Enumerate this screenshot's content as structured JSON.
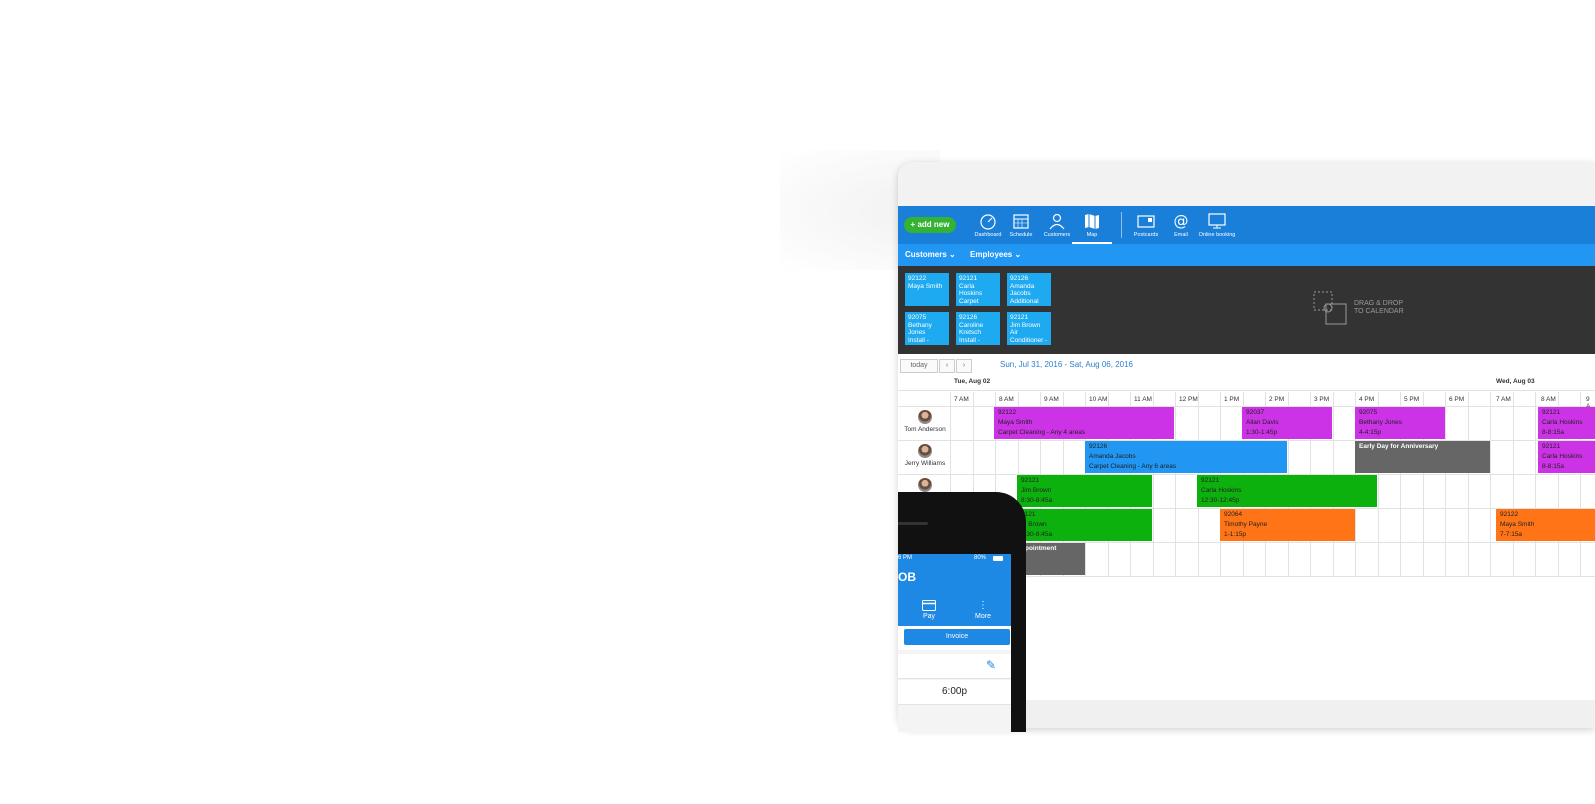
{
  "topbar": {
    "add_new": "+ add new",
    "nav": [
      {
        "label": "Dashboard",
        "icon": "dashboard-icon"
      },
      {
        "label": "Schedule",
        "icon": "calendar-icon"
      },
      {
        "label": "Customers",
        "icon": "person-icon"
      },
      {
        "label": "Map",
        "icon": "map-icon",
        "active": true
      },
      {
        "label": "Postcards",
        "icon": "postcard-icon"
      },
      {
        "label": "Email",
        "icon": "at-icon"
      },
      {
        "label": "Online booking",
        "icon": "monitor-icon"
      }
    ]
  },
  "subbar": {
    "customers": "Customers",
    "employees": "Employees"
  },
  "unscheduled_jobs": [
    {
      "text": "92122\nMaya Smith"
    },
    {
      "text": "92121\nCarla\nHoskins\nCarpet"
    },
    {
      "text": "92126\nAmanda\nJacobs\nAdditional"
    },
    {
      "text": "92075\nBethany\nJones\nInstall -"
    },
    {
      "text": "92126\nCaroline\nKretsch\nInstall -"
    },
    {
      "text": "92121\nJim Brown\nAir\nConditioner -"
    }
  ],
  "drag_drop": {
    "line1": "DRAG & DROP",
    "line2": "TO CALENDAR"
  },
  "datebar": {
    "today": "today",
    "prev": "‹",
    "next": "›",
    "range": "Sun, Jul 31, 2016 - Sat, Aug 06, 2016"
  },
  "calendar": {
    "days": [
      {
        "label": "Tue, Aug 02"
      },
      {
        "label": "Wed, Aug 03"
      }
    ],
    "hours_day1": [
      "7 AM",
      "8 AM",
      "9 AM",
      "10 AM",
      "11 AM",
      "12 PM",
      "1 PM",
      "2 PM",
      "3 PM",
      "4 PM",
      "5 PM",
      "6 PM"
    ],
    "hours_day2": [
      "7 AM",
      "8 AM",
      "9 A"
    ],
    "employees": [
      {
        "name": "Tom Anderson"
      },
      {
        "name": "Jerry Williams"
      },
      {
        "name": ""
      }
    ],
    "appointments": [
      {
        "id": "92122",
        "name": "Maya Smith",
        "detail": "Carpet Cleaning - Any 4 areas"
      },
      {
        "id": "92037",
        "name": "Allan Davis",
        "detail": "1:30-1:45p"
      },
      {
        "id": "92075",
        "name": "Bethany Jones",
        "detail": "4-4:15p"
      },
      {
        "id": "92121",
        "name": "Carla Hoskins",
        "detail": "8-8:15a"
      },
      {
        "id": "92126",
        "name": "Amanda Jacobs",
        "detail": "Carpet Cleaning - Any 6 areas"
      },
      {
        "id": "",
        "name": "Early Day for Anniversary",
        "detail": ""
      },
      {
        "id": "92121",
        "name": "Carla Hoskins",
        "detail": "8-8:15a"
      },
      {
        "id": "92121",
        "name": "Jim Brown",
        "detail": "8:30-8:45a"
      },
      {
        "id": "92121",
        "name": "Carla Hoskins",
        "detail": "12:30-12:45p"
      },
      {
        "id": "2121",
        "name": "m Brown",
        "detail": "8:30-8:45a"
      },
      {
        "id": "92064",
        "name": "Timothy Payne",
        "detail": "1-1:15p"
      },
      {
        "id": "92122",
        "name": "Maya Smith",
        "detail": "7-7:15a"
      },
      {
        "id": "",
        "name": "ppointment",
        "detail": ""
      }
    ],
    "colors": {
      "purple": "#cc33e6",
      "blue": "#2196f3",
      "gray": "#666666",
      "green": "#0db10d",
      "orange": "#ff7417"
    }
  },
  "phone": {
    "status_time": "6 PM",
    "status_battery": "80%",
    "title": "OB",
    "actions": [
      {
        "label": "Pay",
        "icon": "card-icon"
      },
      {
        "label": "More",
        "icon": "more-vert-icon"
      }
    ],
    "invoice": "Invoice",
    "time_value": "6:00p"
  }
}
